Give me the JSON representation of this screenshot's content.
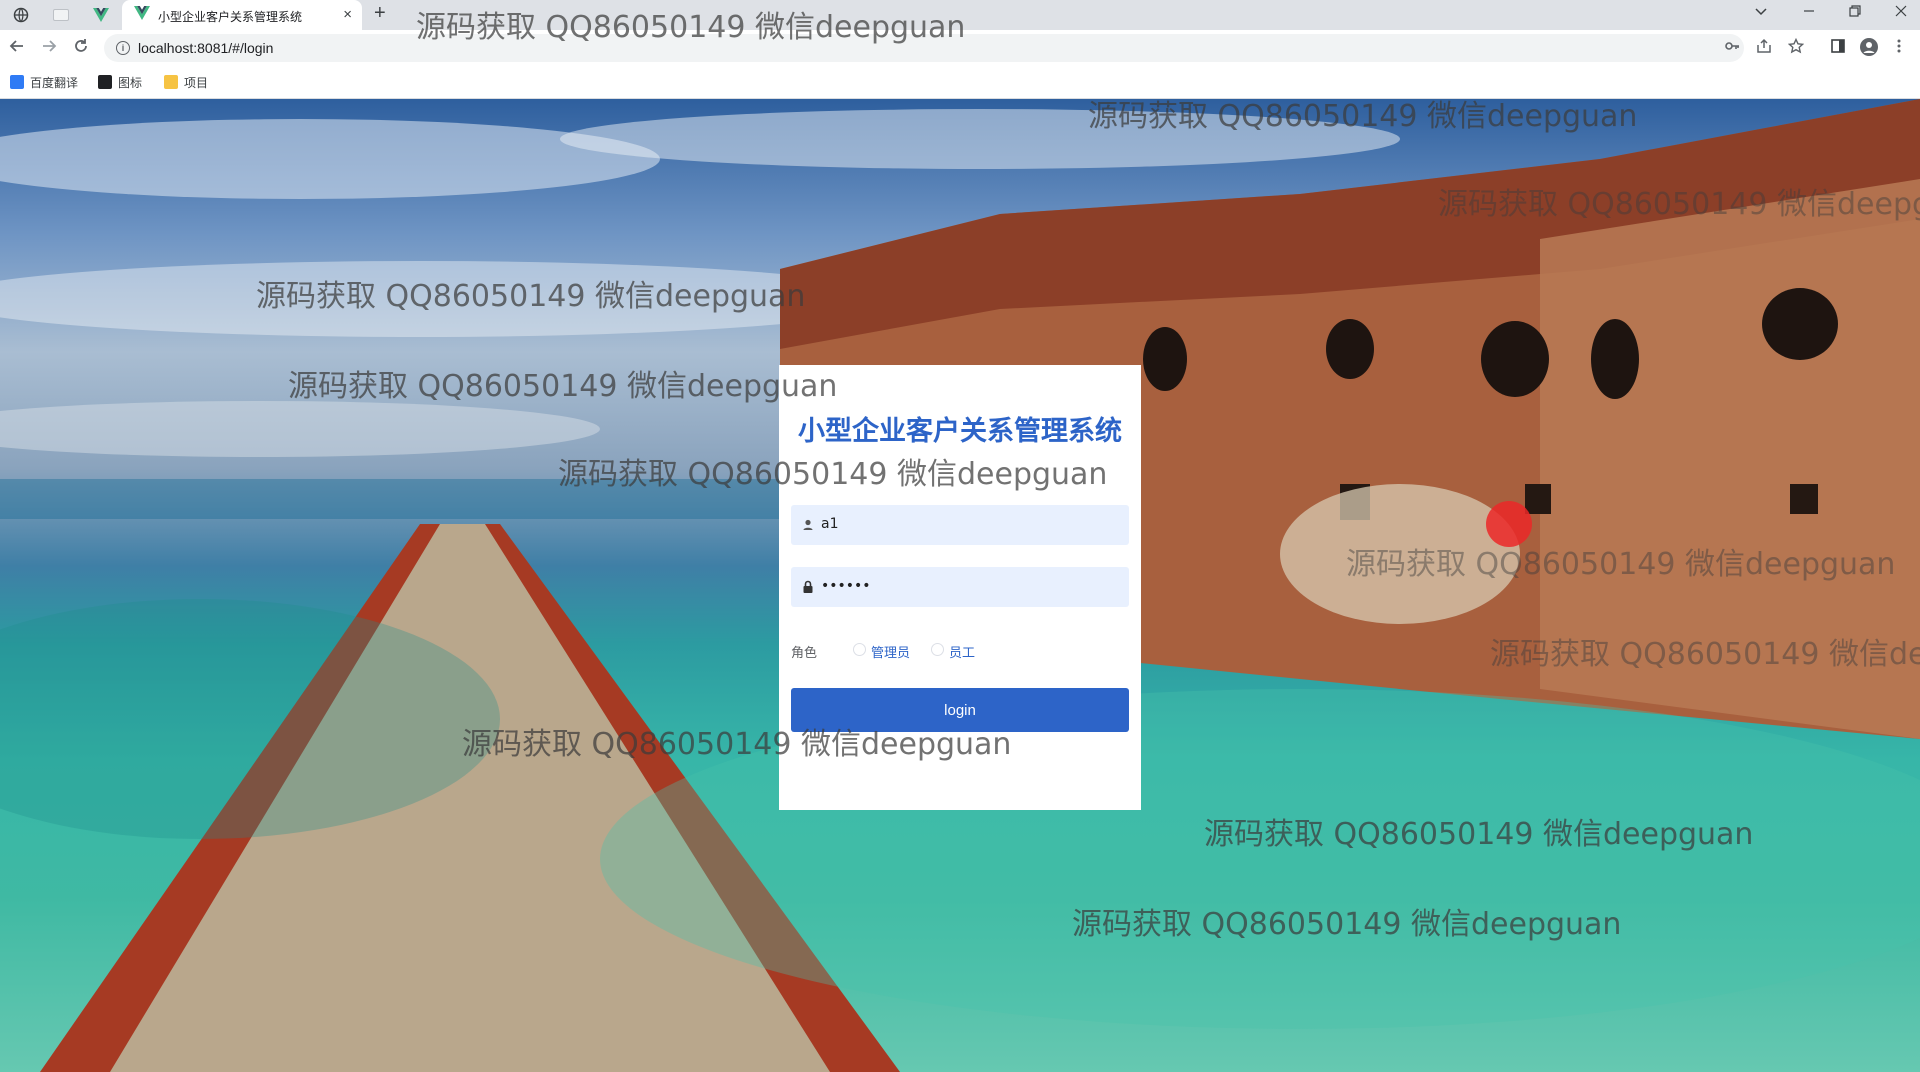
{
  "browser": {
    "active_tab_title": "小型企业客户关系管理系统",
    "tab_close": "×",
    "new_tab": "+",
    "url": "localhost:8081/#/login",
    "bookmarks": [
      {
        "label": "百度翻译",
        "icon": "baidu-translate-icon",
        "color": "#2f7bf5"
      },
      {
        "label": "图标",
        "icon": "image-icon",
        "color": "#202124"
      },
      {
        "label": "项目",
        "icon": "folder-icon",
        "color": "#f6c343"
      }
    ]
  },
  "login": {
    "title": "小型企业客户关系管理系统",
    "username_value": "a1",
    "password_value": "••••••",
    "role_label": "角色",
    "role_options": [
      {
        "label": "管理员",
        "selected": false
      },
      {
        "label": "员工",
        "selected": false
      }
    ],
    "submit_label": "login"
  },
  "watermark": {
    "text": "源码获取 QQ86050149 微信deepguan"
  },
  "colors": {
    "accent": "#2d64c8",
    "input_bg": "#e8f0fe",
    "chrome_bg": "#dee1e6"
  }
}
